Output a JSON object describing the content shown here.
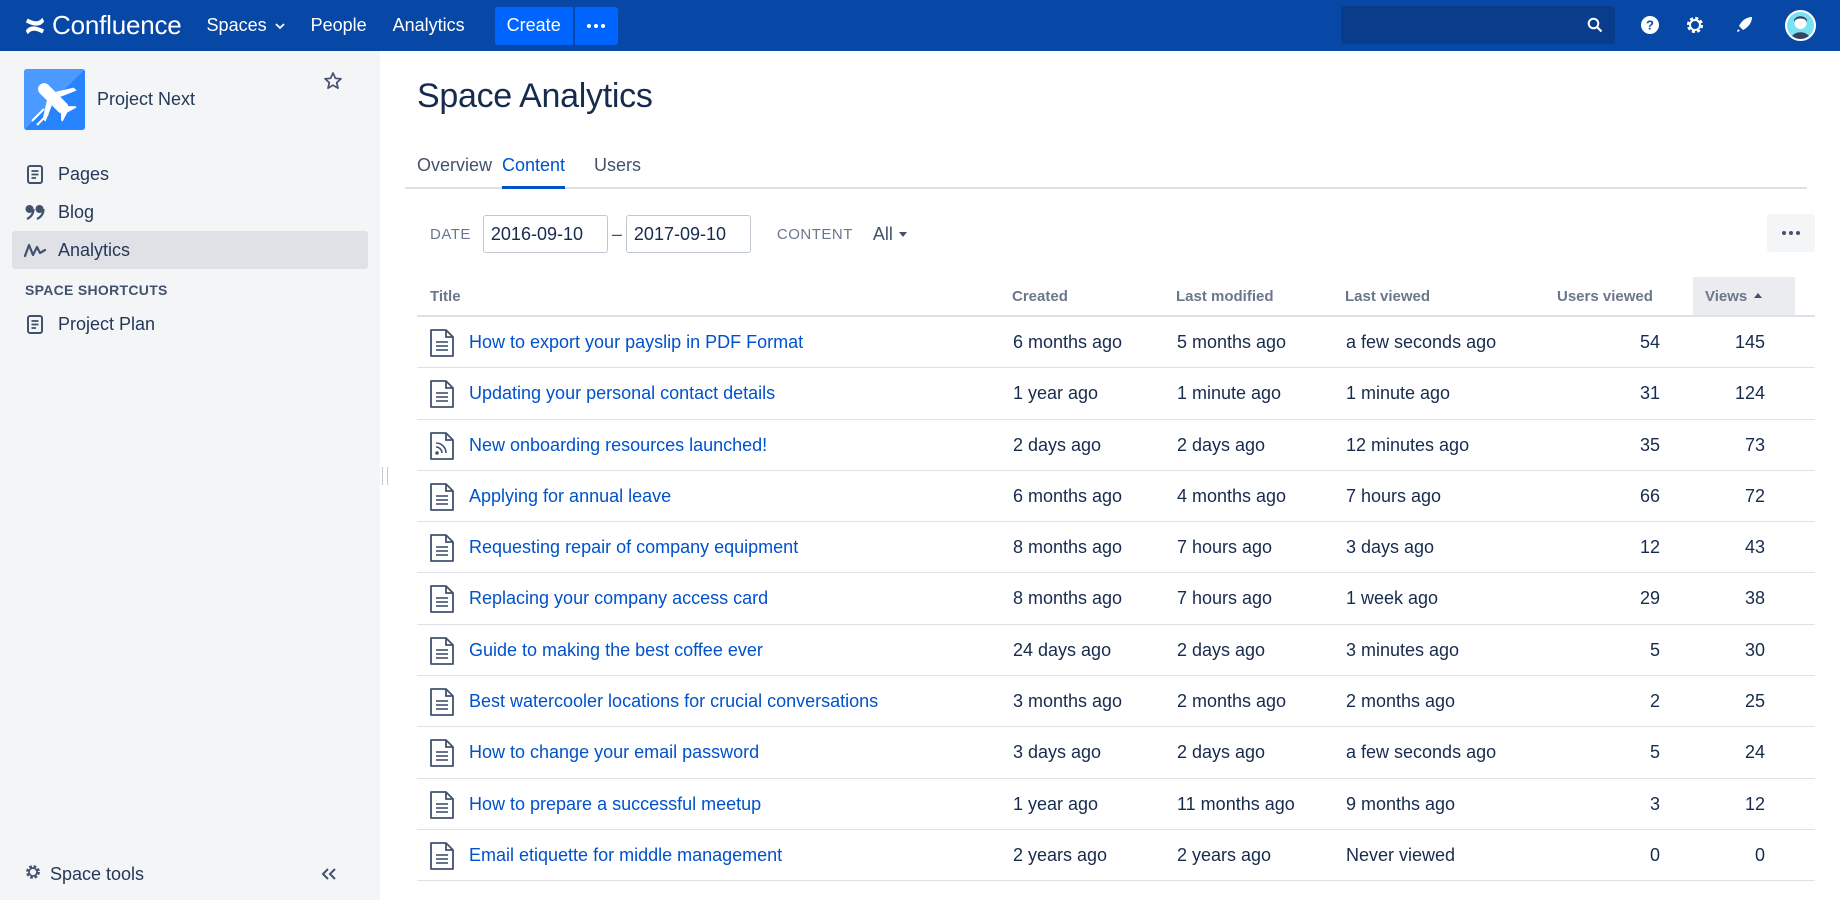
{
  "nav": {
    "brand": "Confluence",
    "items": [
      {
        "label": "Spaces",
        "dropdown": true
      },
      {
        "label": "People"
      },
      {
        "label": "Analytics"
      }
    ],
    "create_label": "Create",
    "search_placeholder": ""
  },
  "sidebar": {
    "space_name": "Project Next",
    "items": [
      {
        "label": "Pages",
        "icon": "page-icon"
      },
      {
        "label": "Blog",
        "icon": "quote-icon"
      },
      {
        "label": "Analytics",
        "icon": "analytics-icon",
        "active": true
      }
    ],
    "shortcuts_heading": "SPACE SHORTCUTS",
    "shortcuts": [
      {
        "label": "Project Plan",
        "icon": "page-icon"
      }
    ],
    "space_tools_label": "Space tools"
  },
  "main": {
    "title": "Space Analytics",
    "tabs": [
      {
        "label": "Overview"
      },
      {
        "label": "Content",
        "active": true
      },
      {
        "label": "Users"
      }
    ],
    "filters": {
      "date_label": "DATE",
      "date_from": "2016-09-10",
      "date_sep": "–",
      "date_to": "2017-09-10",
      "content_label": "CONTENT",
      "content_value": "All"
    },
    "table": {
      "headers": {
        "title": "Title",
        "created": "Created",
        "modified": "Last modified",
        "viewed": "Last viewed",
        "users": "Users viewed",
        "views": "Views"
      },
      "sort": {
        "column": "views",
        "direction": "ascending-indicator"
      },
      "rows": [
        {
          "icon": "page",
          "title": "How to export your payslip in PDF Format",
          "created": "6 months ago",
          "modified": "5 months ago",
          "viewed": "a few seconds ago",
          "users": "54",
          "views": "145"
        },
        {
          "icon": "page",
          "title": "Updating your personal contact details",
          "created": "1 year ago",
          "modified": "1 minute ago",
          "viewed": "1 minute ago",
          "users": "31",
          "views": "124"
        },
        {
          "icon": "blog",
          "title": "New onboarding resources launched!",
          "created": "2 days ago",
          "modified": "2 days ago",
          "viewed": "12 minutes ago",
          "users": "35",
          "views": "73"
        },
        {
          "icon": "page",
          "title": "Applying for annual leave",
          "created": "6 months ago",
          "modified": "4 months ago",
          "viewed": "7 hours ago",
          "users": "66",
          "views": "72"
        },
        {
          "icon": "page",
          "title": "Requesting repair of company equipment",
          "created": "8 months ago",
          "modified": "7 hours ago",
          "viewed": "3 days ago",
          "users": "12",
          "views": "43"
        },
        {
          "icon": "page",
          "title": "Replacing your company access card",
          "created": "8 months ago",
          "modified": "7 hours ago",
          "viewed": "1 week ago",
          "users": "29",
          "views": "38"
        },
        {
          "icon": "page",
          "title": "Guide to making the best coffee ever",
          "created": "24 days ago",
          "modified": "2 days ago",
          "viewed": "3 minutes ago",
          "users": "5",
          "views": "30"
        },
        {
          "icon": "page",
          "title": "Best watercooler locations for crucial conversations",
          "created": "3 months ago",
          "modified": "2 months ago",
          "viewed": "2 months ago",
          "users": "2",
          "views": "25"
        },
        {
          "icon": "page",
          "title": "How to change your email password",
          "created": "3 days ago",
          "modified": "2 days ago",
          "viewed": "a few seconds ago",
          "users": "5",
          "views": "24"
        },
        {
          "icon": "page",
          "title": "How to prepare a successful meetup",
          "created": "1 year ago",
          "modified": "11 months ago",
          "viewed": "9 months ago",
          "users": "3",
          "views": "12"
        },
        {
          "icon": "page",
          "title": "Email etiquette for middle management",
          "created": "2 years ago",
          "modified": "2 years ago",
          "viewed": "Never viewed",
          "users": "0",
          "views": "0"
        }
      ]
    }
  },
  "colors": {
    "nav_bg": "#0747a6",
    "create_bg": "#0065ff",
    "link": "#0052cc",
    "sidebar_bg": "#f4f5f7"
  }
}
